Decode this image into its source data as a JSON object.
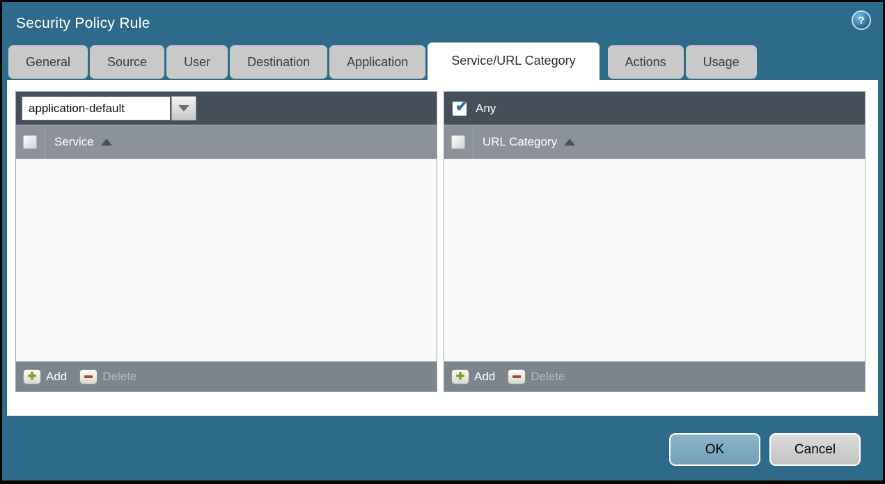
{
  "dialog": {
    "title": "Security Policy Rule",
    "help_glyph": "?"
  },
  "tabs": [
    {
      "label": "General",
      "active": false
    },
    {
      "label": "Source",
      "active": false
    },
    {
      "label": "User",
      "active": false
    },
    {
      "label": "Destination",
      "active": false
    },
    {
      "label": "Application",
      "active": false
    },
    {
      "label": "Service/URL Category",
      "active": true
    },
    {
      "label": "Actions",
      "active": false
    },
    {
      "label": "Usage",
      "active": false
    }
  ],
  "service_panel": {
    "dropdown_value": "application-default",
    "column_header": "Service",
    "sort_ascending": true,
    "select_all_checked": false,
    "rows": [],
    "add_label": "Add",
    "delete_label": "Delete",
    "delete_enabled": false
  },
  "url_category_panel": {
    "any_label": "Any",
    "any_checked": true,
    "column_header": "URL Category",
    "sort_ascending": true,
    "select_all_checked": false,
    "rows": [],
    "add_label": "Add",
    "delete_label": "Delete",
    "delete_enabled": false
  },
  "footer": {
    "ok_label": "OK",
    "cancel_label": "Cancel"
  },
  "icons": {
    "check_glyph": "✔",
    "add_glyph": "✚"
  },
  "colors": {
    "background_teal": "#2e6b8b",
    "panel_header_dark": "#454f59",
    "column_header_gray": "#8b9299",
    "panel_footer_gray": "#7d858c",
    "tab_gray": "#c9c9c9",
    "ok_button_blue": "#7dadc4",
    "cancel_button_gray": "#cfcfcf",
    "check_blue": "#2c74aa",
    "add_green": "#7da01c",
    "delete_red": "#a34a38"
  }
}
